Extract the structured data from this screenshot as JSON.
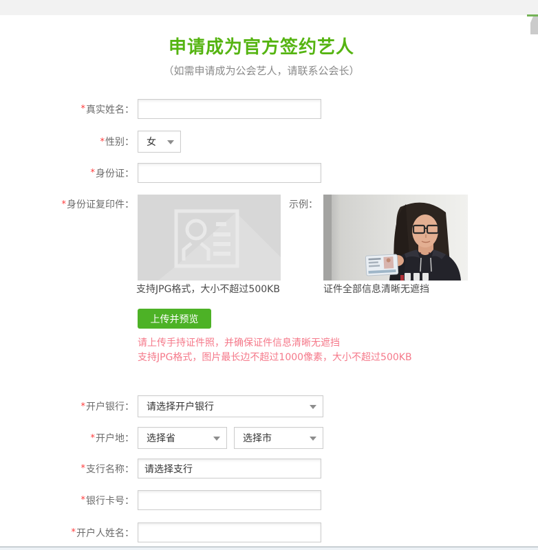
{
  "header": {
    "title": "申请成为官方签约艺人",
    "subtitle": "（如需申请成为公会艺人，请联系公会长）"
  },
  "form": {
    "required_mark": "*",
    "real_name_label": "真实姓名：",
    "gender_label": "性别：",
    "gender_value": "女",
    "id_label": "身份证：",
    "id_copy_label": "身份证复印件：",
    "upload_hint": "支持JPG格式，大小不超过500KB",
    "example_label": "示例：",
    "example_caption": "证件全部信息清晰无遮挡",
    "upload_button_label": "上传并预览",
    "warning_line1": "请上传手持证件照，并确保证件信息清晰无遮挡",
    "warning_line2": "支持JPG格式，图片最长边不超过1000像素，大小不超过500KB",
    "bank_label": "开户银行：",
    "bank_value": "请选择开户银行",
    "location_label": "开户地：",
    "province_value": "选择省",
    "city_value": "选择市",
    "branch_label": "支行名称：",
    "branch_value": "请选择支行",
    "card_label": "银行卡号：",
    "holder_label": "开户人姓名："
  },
  "colors": {
    "title_green": "#55b411",
    "button_green": "#4db226",
    "warning_pink": "#f5798a",
    "required_red": "#ff3a3a",
    "label_gray": "#6b6b6b",
    "top_strip_gray": "#f2f2f2",
    "scrollbar_green": "#74b356"
  }
}
